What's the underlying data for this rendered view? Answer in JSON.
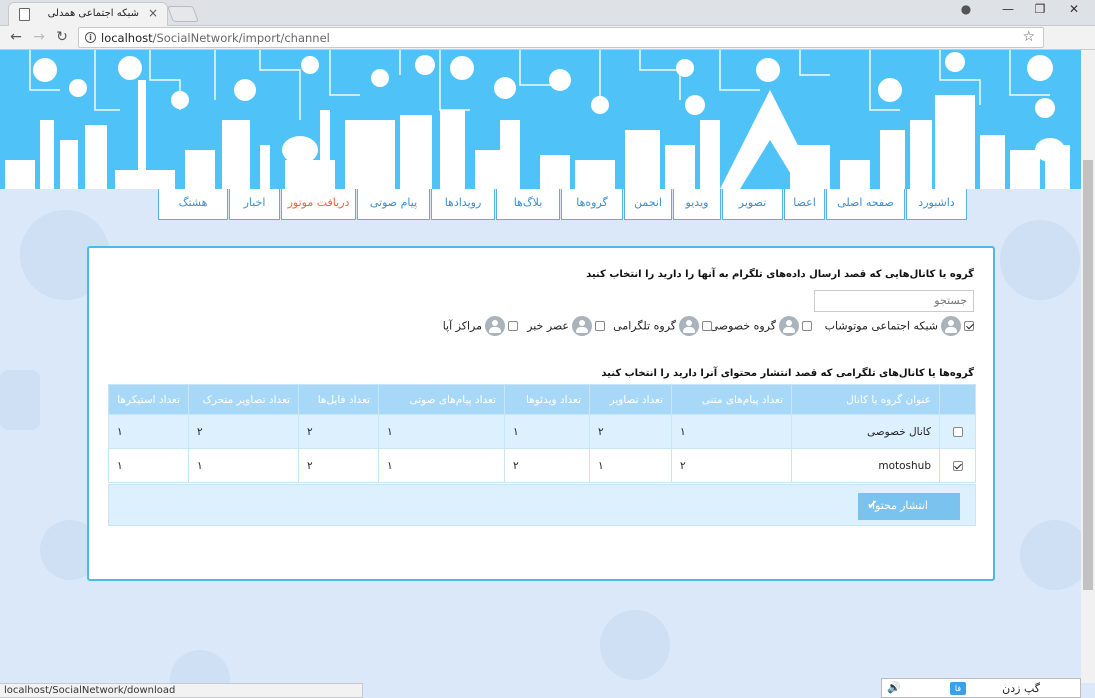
{
  "browser": {
    "tab_title": "شبکه اجتماعی همدلی",
    "tab_close": "×",
    "url_host": "localhost",
    "url_path": "/SocialNetwork/import/channel",
    "info_icon": "i",
    "back": "←",
    "forward": "→",
    "reload": "↻",
    "star": "☆",
    "menu": "⋮",
    "minimize": "—",
    "maximize": "❐",
    "close": "✕",
    "account": "●"
  },
  "nav": {
    "items": [
      {
        "label": "داشبورد"
      },
      {
        "label": "صفحه اصلی"
      },
      {
        "label": "اعضا"
      },
      {
        "label": "تصویر"
      },
      {
        "label": "ویدیو"
      },
      {
        "label": "انجمن"
      },
      {
        "label": "گروه‌ها"
      },
      {
        "label": "بلاگ‌ها"
      },
      {
        "label": "رویدادها"
      },
      {
        "label": "پیام صوتی"
      },
      {
        "label": "دریافت موتور",
        "active": true
      },
      {
        "label": "اخبار"
      },
      {
        "label": "هشتگ"
      }
    ]
  },
  "panel": {
    "select_heading": "گروه یا کانال‌هایی که قصد ارسال داده‌های تلگرام به آنها را دارید را انتخاب کنید",
    "search_placeholder": "جستجو",
    "targets": [
      {
        "label": "شبکه اجتماعی موتوشاب",
        "checked": true
      },
      {
        "label": "گروه خصوصی",
        "checked": false
      },
      {
        "label": "گروه تلگرامی",
        "checked": false
      },
      {
        "label": "عصر خبر",
        "checked": false
      },
      {
        "label": "مراکز آپا",
        "checked": false
      }
    ],
    "content_heading": "گروه‌ها یا کانال‌های تلگرامی که قصد انتشار محتوای آنرا دارید را انتخاب کنید",
    "table": {
      "columns": [
        "عنوان گروه یا کانال",
        "تعداد پیام‌های متنی",
        "تعداد تصاویر",
        "تعداد ویدئوها",
        "تعداد پیام‌های صوتی",
        "تعداد فایل‌ها",
        "تعداد تصاویر متحرک",
        "تعداد استیکرها"
      ],
      "rows": [
        {
          "checked": false,
          "cells": [
            "کانال خصوصی",
            "۱",
            "۲",
            "۱",
            "۱",
            "۲",
            "۲",
            "۱"
          ]
        },
        {
          "checked": true,
          "cells": [
            "motoshub",
            "۲",
            "۱",
            "۲",
            "۱",
            "۲",
            "۱",
            "۱"
          ]
        }
      ]
    },
    "publish_label": "انتشار محتوا",
    "publish_icon": "✔"
  },
  "status_bar": "localhost/SocialNetwork/download",
  "ime": {
    "text": "گپ زدن",
    "badge": "فا",
    "speaker": "🔊"
  }
}
